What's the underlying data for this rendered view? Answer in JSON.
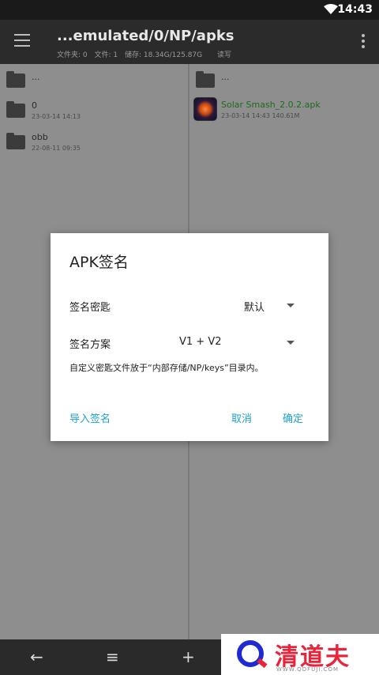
{
  "status": {
    "time": "14:43",
    "wifi_icon": "wifi-icon"
  },
  "toolbar": {
    "title": "...emulated/0/NP/apks",
    "folders": "文件夹: 0",
    "files": "文件: 1",
    "storage": "储存: 18.34G/125.87G",
    "mode": "读写"
  },
  "left_pane": {
    "items": [
      {
        "name": "...",
        "meta": ""
      },
      {
        "name": "0",
        "meta": "23-03-14 14:13"
      },
      {
        "name": "obb",
        "meta": "22-08-11 09:35"
      }
    ]
  },
  "right_pane": {
    "items": [
      {
        "name": "...",
        "meta": ""
      },
      {
        "name": "Solar Smash_2.0.2.apk",
        "meta": "23-03-14 14:43  140.61M"
      }
    ]
  },
  "dialog": {
    "title": "APK签名",
    "key_label": "签名密匙",
    "key_value": "默认",
    "scheme_label": "签名方案",
    "scheme_value": "V1 + V2",
    "note": "自定义密匙文件放于“内部存储/NP/keys”目录内。",
    "import": "导入签名",
    "cancel": "取消",
    "ok": "确定"
  },
  "bottom": {
    "back": "←",
    "list": "≡",
    "add": "+"
  },
  "watermark": {
    "brand": "清道夫",
    "url": "WWW.QDFUJI.COM"
  },
  "colors": {
    "accent": "#1ea1c8",
    "apk_name": "#1e6b1e",
    "watermark": "#e8233a"
  }
}
